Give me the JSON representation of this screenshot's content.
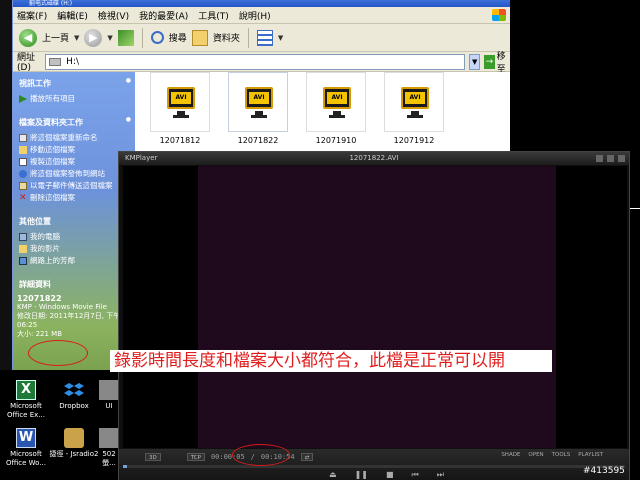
{
  "explorer": {
    "title": "蓟电式磁碟 (H:)",
    "menu": [
      "檔案(F)",
      "編輯(E)",
      "檢視(V)",
      "我的最愛(A)",
      "工具(T)",
      "說明(H)"
    ],
    "toolbar": {
      "back": "上一頁",
      "search": "搜尋",
      "folders": "資料夾"
    },
    "address": {
      "label": "網址(D)",
      "value": "H:\\",
      "go": "移至"
    },
    "side": {
      "video_tasks": {
        "title": "視訊工作",
        "items": [
          "播放所有項目"
        ]
      },
      "file_tasks": {
        "title": "檔案及資料夾工作",
        "items": [
          "將這個檔案重新命名",
          "移動這個檔案",
          "複製這個檔案",
          "將這個檔案發佈到網站",
          "以電子郵件傳送這個檔案",
          "刪除這個檔案"
        ]
      },
      "other_places": {
        "title": "其他位置",
        "items": [
          "我的電腦",
          "我的影片",
          "網路上的芳鄰"
        ]
      },
      "details": {
        "title": "詳細資料",
        "name": "12071822",
        "type": "KMP - Windows Movie File",
        "modified": "修改日期: 2011年12月7日, 下午 06:25",
        "size": "大小: 221 MB"
      }
    },
    "files": [
      {
        "name": "12071812"
      },
      {
        "name": "12071822"
      },
      {
        "name": "12071910"
      },
      {
        "name": "12071912"
      }
    ]
  },
  "desktop": {
    "icons": [
      {
        "label": "Microsoft Office Ex..."
      },
      {
        "label": "Dropbox"
      },
      {
        "label": "UI"
      },
      {
        "label": "Microsoft Office Wo..."
      },
      {
        "label": "捷徑 - Jsradio2"
      },
      {
        "label": "502螢..."
      }
    ]
  },
  "kmplayer": {
    "app": "KMPlayer",
    "title": "12071822.AVI",
    "time_current": "00:00:05",
    "time_total": "00:10:54",
    "chip_left": "3D",
    "chip_mid": "TCP",
    "progress": 0.008,
    "right_buttons": [
      "SHADE",
      "OPEN",
      "TOOLS",
      "PLAYLIST"
    ]
  },
  "caption": "錄影時間長度和檔案大小都符合，此檔是正常可以開",
  "watermark": "#413595",
  "colors": {
    "annotation": "#d81b1b",
    "caption_text": "#e01e1e"
  }
}
